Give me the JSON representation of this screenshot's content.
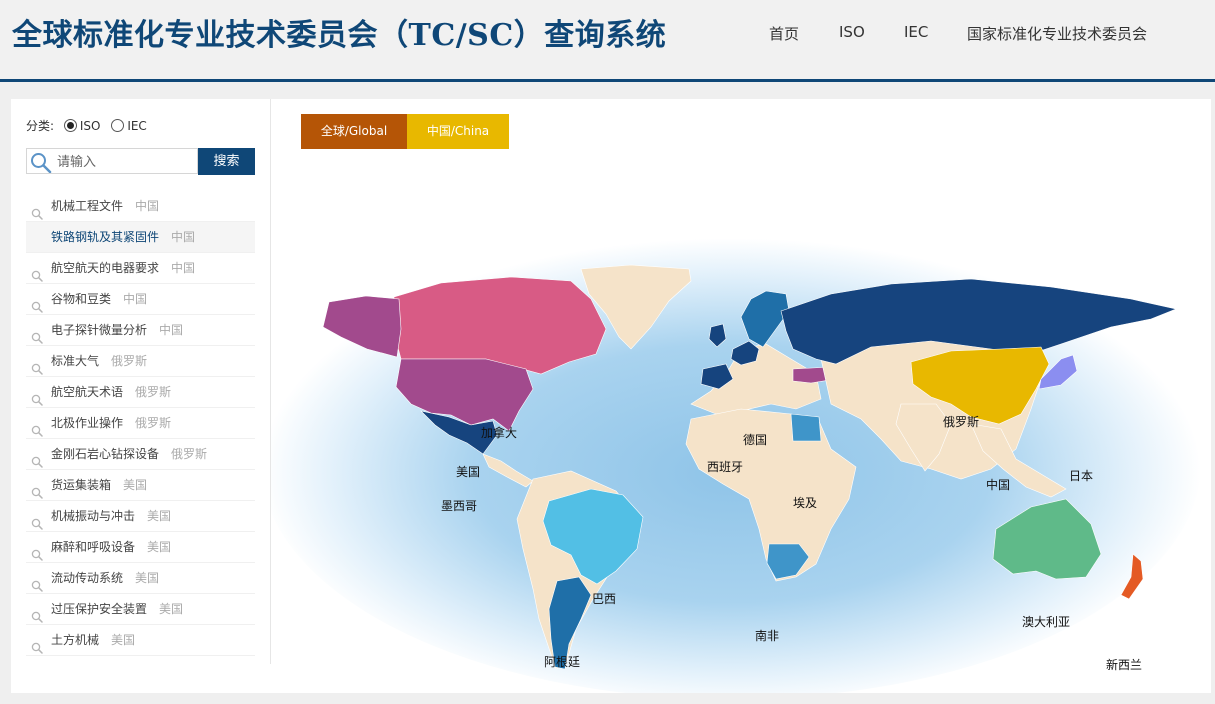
{
  "header": {
    "title": "全球标准化专业技术委员会（TC/SC）查询系统",
    "nav": [
      "首页",
      "ISO",
      "IEC",
      "国家标准化专业技术委员会"
    ]
  },
  "sidebar": {
    "filter_label": "分类:",
    "options": [
      {
        "label": "ISO",
        "selected": true
      },
      {
        "label": "IEC",
        "selected": false
      }
    ],
    "search": {
      "placeholder": "请输入",
      "button": "搜索"
    },
    "items": [
      {
        "name": "机械工程文件",
        "country": "中国"
      },
      {
        "name": "铁路钢轨及其紧固件",
        "country": "中国"
      },
      {
        "name": "航空航天的电器要求",
        "country": "中国"
      },
      {
        "name": "谷物和豆类",
        "country": "中国"
      },
      {
        "name": "电子探针微量分析",
        "country": "中国"
      },
      {
        "name": "标准大气",
        "country": "俄罗斯"
      },
      {
        "name": "航空航天术语",
        "country": "俄罗斯"
      },
      {
        "name": "北极作业操作",
        "country": "俄罗斯"
      },
      {
        "name": "金刚石岩心钻探设备",
        "country": "俄罗斯"
      },
      {
        "name": "货运集装箱",
        "country": "美国"
      },
      {
        "name": "机械振动与冲击",
        "country": "美国"
      },
      {
        "name": "麻醉和呼吸设备",
        "country": "美国"
      },
      {
        "name": "流动传动系统",
        "country": "美国"
      },
      {
        "name": "过压保护安全装置",
        "country": "美国"
      },
      {
        "name": "土方机械",
        "country": "美国"
      }
    ],
    "active_index": 1
  },
  "tabs": [
    {
      "label": "全球/Global",
      "color": "#b55506"
    },
    {
      "label": "中国/China",
      "color": "#e8b800"
    }
  ],
  "map": {
    "labels": [
      "加拿大",
      "美国",
      "墨西哥",
      "巴西",
      "阿根廷",
      "俄罗斯",
      "中国",
      "日本",
      "德国",
      "西班牙",
      "埃及",
      "南非",
      "澳大利亚",
      "新西兰"
    ]
  },
  "colors": {
    "brand": "#0f4777",
    "land": "#f5e3c9",
    "ocean": "#8fc4e8",
    "canada": "#d85b85",
    "usa": "#a24a8d",
    "mexico": "#16447e",
    "brazil": "#52bfe5",
    "argentina": "#1f6fa8",
    "russia": "#16447e",
    "china": "#e8b800",
    "japan": "#8b8ef0",
    "australia": "#5fba89",
    "newzealand": "#e45a24",
    "egypt": "#3f95c9",
    "southafrica": "#3f95c9"
  }
}
